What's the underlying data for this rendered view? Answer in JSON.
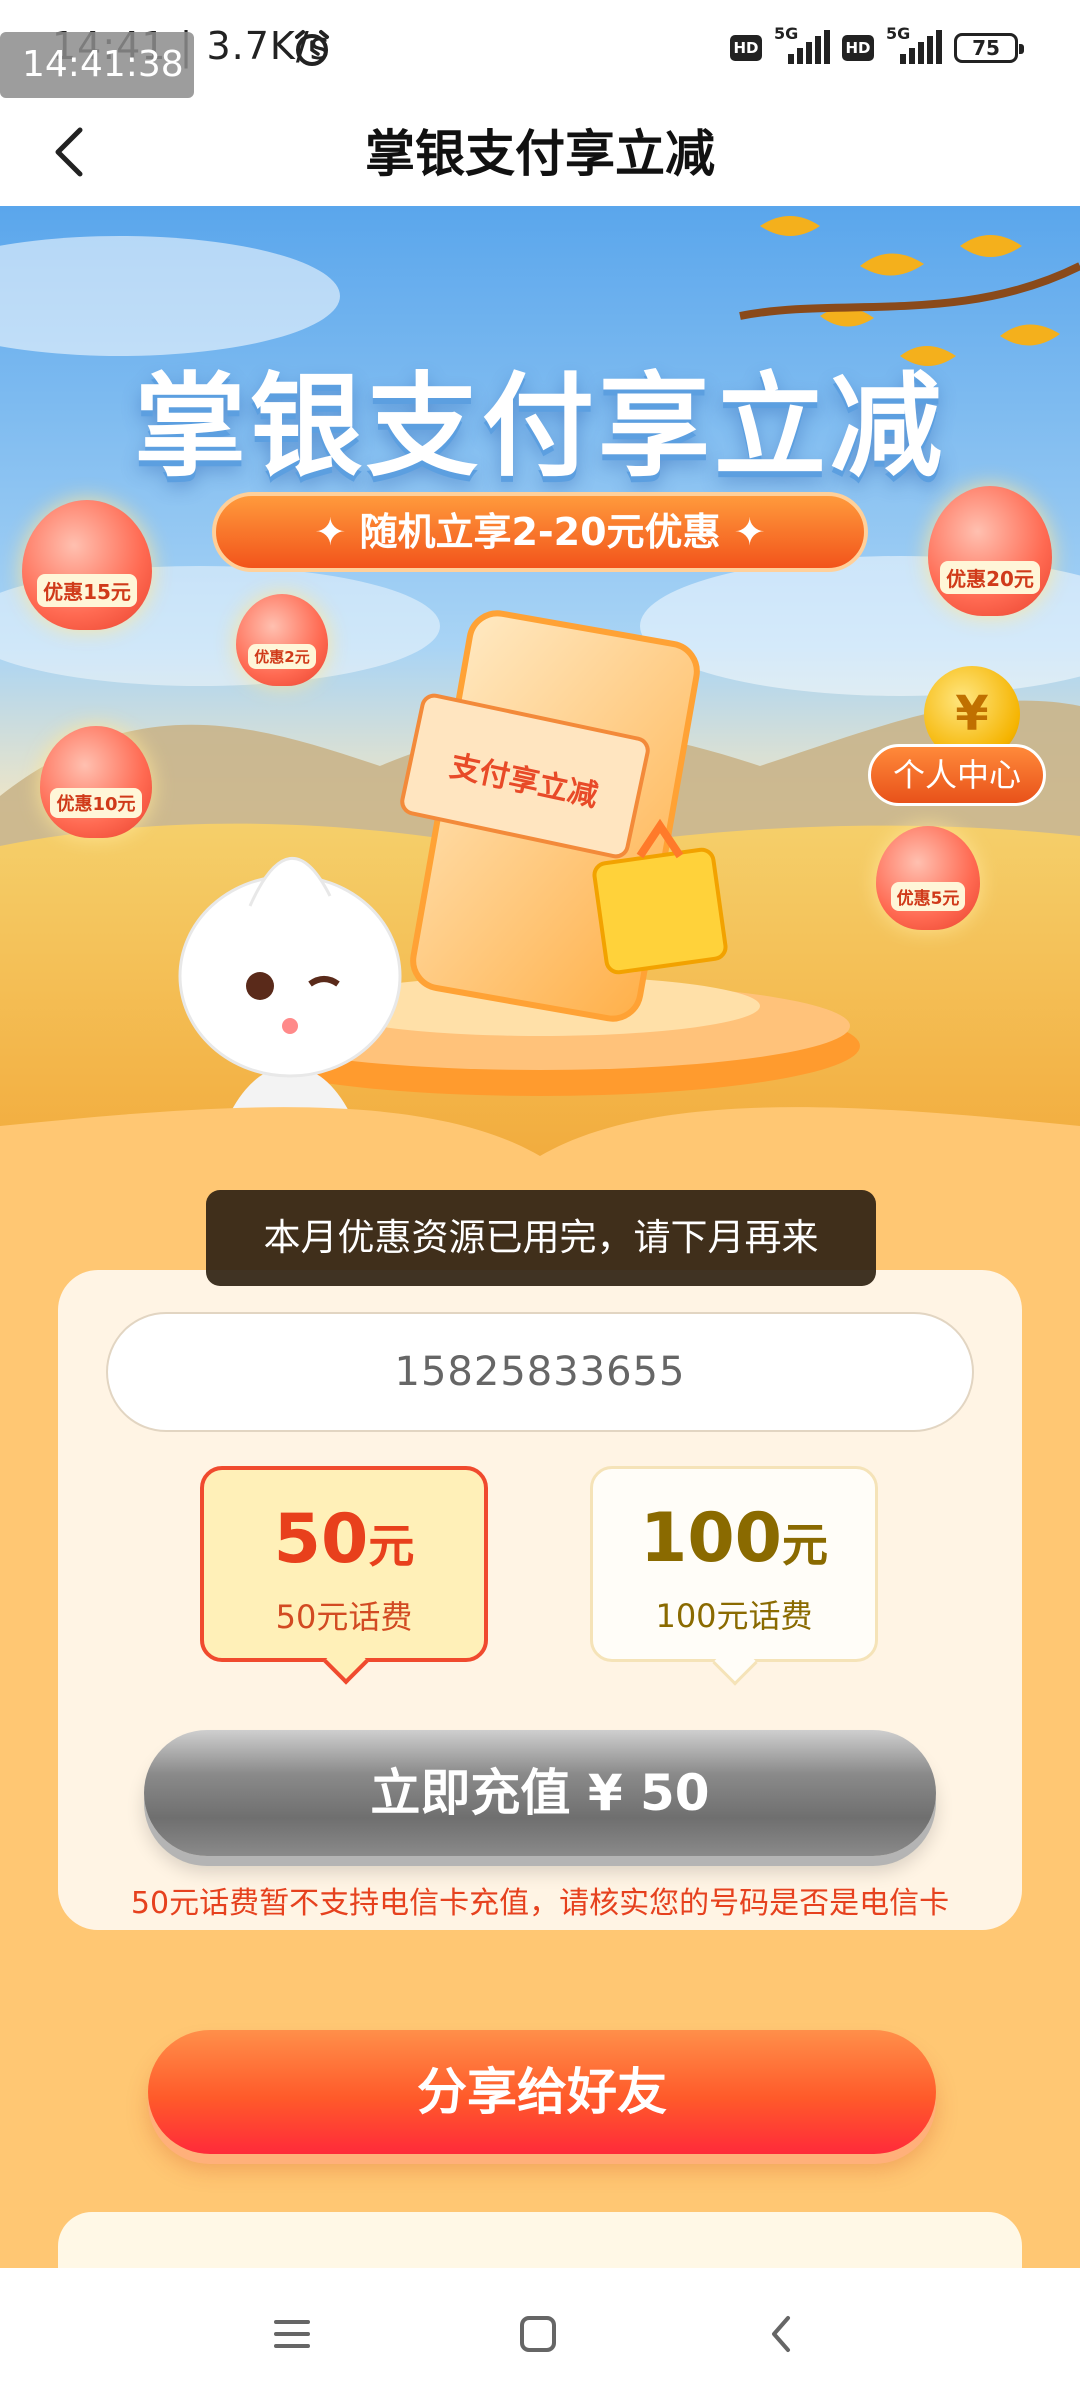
{
  "status_bar": {
    "time_network": "14:41 | 3.7K/s",
    "overlay_clock": "14:41:38",
    "sim1_label": "5G",
    "sim2_label": "5G",
    "hd_label": "HD",
    "battery": "75"
  },
  "header": {
    "title": "掌银支付享立减"
  },
  "hero": {
    "title": "掌银支付享立减",
    "pill": "✦ 随机立享2-20元优惠 ✦",
    "lanterns": [
      "优惠15元",
      "优惠2元",
      "优惠10元",
      "优惠20元",
      "优惠5元"
    ],
    "ticket_text": "支付享立减",
    "coin_symbol": "¥",
    "personal_center": "个人中心"
  },
  "toast": "本月优惠资源已用完，请下月再来",
  "card": {
    "phone_value": "15825833655",
    "options": [
      {
        "amount": "50",
        "unit": "元",
        "sub": "50元话费",
        "selected": true
      },
      {
        "amount": "100",
        "unit": "元",
        "sub": "100元话费",
        "selected": false
      }
    ],
    "recharge_label": "立即充值 ¥ 50",
    "notice": "50元话费暂不支持电信卡充值，请核实您的号码是否是电信卡"
  },
  "share_label": "分享给好友",
  "colors": {
    "accent_red": "#e8401c",
    "share_gradient_end": "#ff2a3a",
    "page_bg": "#ffc773"
  }
}
